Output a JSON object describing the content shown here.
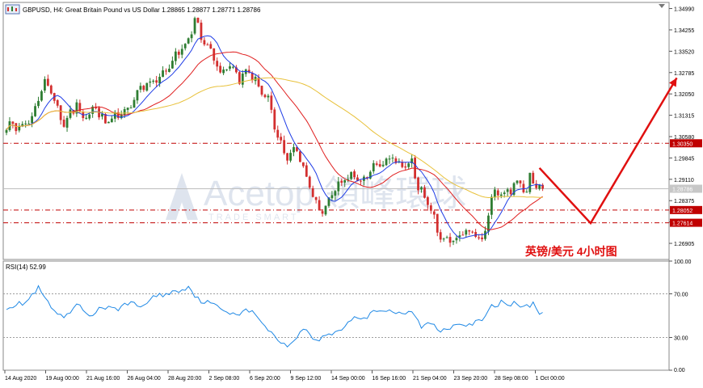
{
  "window": {
    "symbol_line": "GBPUSD, H4:  Great Britain Pound vs US Dollar  1.28865 1.28877 1.28771 1.28786"
  },
  "annotation": {
    "text": "英镑/美元    4小时图"
  },
  "watermark": {
    "text_main": "Acetop 領峰環球",
    "text_sub": "TRADE SMART"
  },
  "colors": {
    "bull": "#2e7d32",
    "bear": "#d32f2f",
    "ma_fast": "#1e3ce6",
    "ma_mid": "#e02020",
    "ma_slow": "#e8c13a",
    "level_line": "#c00000",
    "rsi_line": "#1e88e5",
    "arrow": "#e01010",
    "current_price_box": "#c7c7c7"
  },
  "chart_data": [
    {
      "type": "candlestick",
      "title": "GBPUSD, H4",
      "ylim": [
        1.2635,
        1.352
      ],
      "y_ticks": [
        "1.34990",
        "1.34255",
        "1.33520",
        "1.32785",
        "1.32050",
        "1.31315",
        "1.30580",
        "1.29845",
        "1.29110",
        "1.28375",
        "1.27640",
        "1.26905"
      ],
      "x_ticks": [
        "14 Aug 2020",
        "19 Aug 00:00",
        "21 Aug 16:00",
        "26 Aug 04:00",
        "28 Aug 20:00",
        "2 Sep 08:00",
        "6 Sep 20:00",
        "9 Sep 12:00",
        "14 Sep 00:00",
        "16 Sep 16:00",
        "21 Sep 04:00",
        "23 Sep 20:00",
        "28 Sep 08:00",
        "1 Oct 00:00"
      ],
      "close_anchors": [
        [
          0,
          1.309
        ],
        [
          8,
          1.311
        ],
        [
          10,
          1.3195
        ],
        [
          12,
          1.325
        ],
        [
          15,
          1.3185
        ],
        [
          18,
          1.3105
        ],
        [
          22,
          1.317
        ],
        [
          24,
          1.3112
        ],
        [
          28,
          1.316
        ],
        [
          31,
          1.31
        ],
        [
          35,
          1.313
        ],
        [
          38,
          1.315
        ],
        [
          42,
          1.323
        ],
        [
          47,
          1.325
        ],
        [
          51,
          1.33
        ],
        [
          54,
          1.3355
        ],
        [
          57,
          1.339
        ],
        [
          59,
          1.3465
        ],
        [
          61,
          1.3395
        ],
        [
          64,
          1.336
        ],
        [
          67,
          1.328
        ],
        [
          70,
          1.331
        ],
        [
          73,
          1.326
        ],
        [
          76,
          1.3285
        ],
        [
          79,
          1.323
        ],
        [
          82,
          1.318
        ],
        [
          85,
          1.305
        ],
        [
          88,
          1.299
        ],
        [
          91,
          1.3015
        ],
        [
          93,
          1.295
        ],
        [
          96,
          1.286
        ],
        [
          98,
          1.28
        ],
        [
          101,
          1.284
        ],
        [
          103,
          1.288
        ],
        [
          107,
          1.2925
        ],
        [
          111,
          1.29
        ],
        [
          114,
          1.294
        ],
        [
          118,
          1.2975
        ],
        [
          121,
          1.299
        ],
        [
          124,
          1.295
        ],
        [
          127,
          1.297
        ],
        [
          129,
          1.289
        ],
        [
          131,
          1.284
        ],
        [
          133,
          1.281
        ],
        [
          135,
          1.273
        ],
        [
          138,
          1.2695
        ],
        [
          141,
          1.27
        ],
        [
          144,
          1.273
        ],
        [
          147,
          1.272
        ],
        [
          149,
          1.269
        ],
        [
          151,
          1.279
        ],
        [
          153,
          1.288
        ],
        [
          156,
          1.286
        ],
        [
          158,
          1.288
        ],
        [
          161,
          1.29
        ],
        [
          163,
          1.287
        ],
        [
          164,
          1.293
        ],
        [
          166,
          1.2895
        ],
        [
          168,
          1.2879
        ]
      ],
      "moving_averages": [
        {
          "name": "MA fast",
          "period": 8,
          "color_key": "ma_fast"
        },
        {
          "name": "MA mid",
          "period": 21,
          "color_key": "ma_mid"
        },
        {
          "name": "MA slow",
          "period": 55,
          "color_key": "ma_slow"
        }
      ],
      "horizontal_levels": [
        {
          "value": 1.3035,
          "label": "1.30350",
          "style": "dash-dot"
        },
        {
          "value": 1.28052,
          "label": "1.28052",
          "style": "dash-dot"
        },
        {
          "value": 1.27614,
          "label": "1.27614",
          "style": "dash-dot"
        }
      ],
      "current_price": {
        "value": 1.28786,
        "label": "1.28786"
      },
      "projection_path": [
        {
          "x_index": 167,
          "y": 1.295
        },
        {
          "x_index": 183,
          "y": 1.276
        },
        {
          "x_index": 210,
          "y": 1.326
        }
      ]
    },
    {
      "type": "line",
      "title": "RSI(14) 52.99",
      "label": "RSI(14) 52.99",
      "ylim": [
        0,
        100
      ],
      "y_ticks": [
        "100.00",
        "70.00",
        "30.00",
        "0.00"
      ],
      "levels": [
        70,
        30
      ],
      "value_anchors": [
        [
          0,
          58
        ],
        [
          6,
          62
        ],
        [
          10,
          75
        ],
        [
          14,
          57
        ],
        [
          18,
          46
        ],
        [
          22,
          60
        ],
        [
          26,
          50
        ],
        [
          30,
          58
        ],
        [
          34,
          55
        ],
        [
          38,
          62
        ],
        [
          42,
          58
        ],
        [
          46,
          67
        ],
        [
          50,
          70
        ],
        [
          54,
          73
        ],
        [
          57,
          77
        ],
        [
          60,
          65
        ],
        [
          64,
          61
        ],
        [
          68,
          55
        ],
        [
          72,
          52
        ],
        [
          76,
          55
        ],
        [
          80,
          45
        ],
        [
          83,
          33
        ],
        [
          86,
          27
        ],
        [
          88,
          21
        ],
        [
          91,
          32
        ],
        [
          94,
          38
        ],
        [
          97,
          26
        ],
        [
          100,
          32
        ],
        [
          103,
          35
        ],
        [
          106,
          40
        ],
        [
          109,
          50
        ],
        [
          112,
          46
        ],
        [
          115,
          56
        ],
        [
          118,
          55
        ],
        [
          121,
          54
        ],
        [
          124,
          50
        ],
        [
          127,
          54
        ],
        [
          130,
          40
        ],
        [
          133,
          43
        ],
        [
          136,
          36
        ],
        [
          139,
          40
        ],
        [
          142,
          44
        ],
        [
          145,
          42
        ],
        [
          149,
          45
        ],
        [
          152,
          58
        ],
        [
          155,
          62
        ],
        [
          157,
          62
        ],
        [
          160,
          60
        ],
        [
          163,
          58
        ],
        [
          165,
          62
        ],
        [
          167,
          52
        ],
        [
          168,
          53
        ]
      ]
    }
  ]
}
